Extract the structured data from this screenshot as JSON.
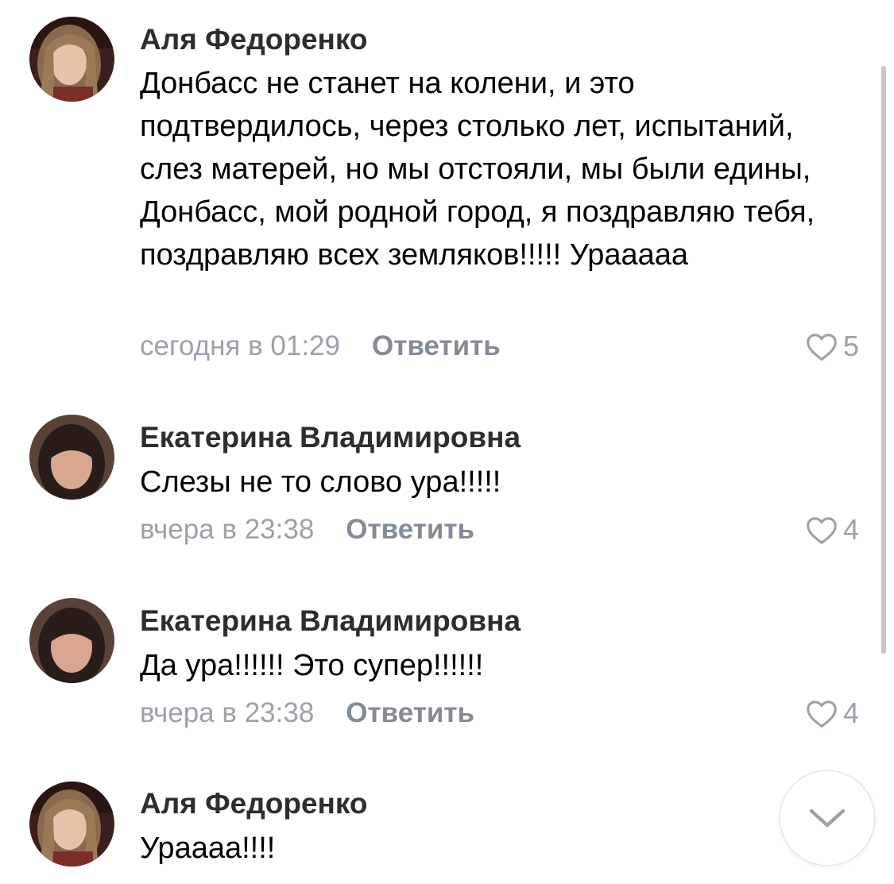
{
  "comments": [
    {
      "author": "Аля Федоренко",
      "text": "Донбасс не станет на колени, и это подтвердилось, через столько лет, испытаний, слез матерей, но мы отстояли, мы были едины, Донбасс, мой родной город, я поздравляю тебя, поздравляю всех земляков!!!!! Урааааа",
      "time": "сегодня в 01:29",
      "reply_label": "Ответить",
      "likes": "5"
    },
    {
      "author": "Екатерина Владимировна",
      "text": "Слезы не то слово ура!!!!!",
      "time": "вчера в 23:38",
      "reply_label": "Ответить",
      "likes": "4"
    },
    {
      "author": "Екатерина Владимировна",
      "text": "Да ура!!!!!! Это супер!!!!!!",
      "time": "вчера в 23:38",
      "reply_label": "Ответить",
      "likes": "4"
    },
    {
      "author": "Аля Федоренко",
      "text": "Урааaa!!!!"
    }
  ],
  "icons": {
    "like": "heart-outline-icon",
    "scroll_down": "chevron-down-icon"
  },
  "colors": {
    "author": "#2c2d2e",
    "meta": "#99a2ad",
    "reply": "#818c99"
  }
}
